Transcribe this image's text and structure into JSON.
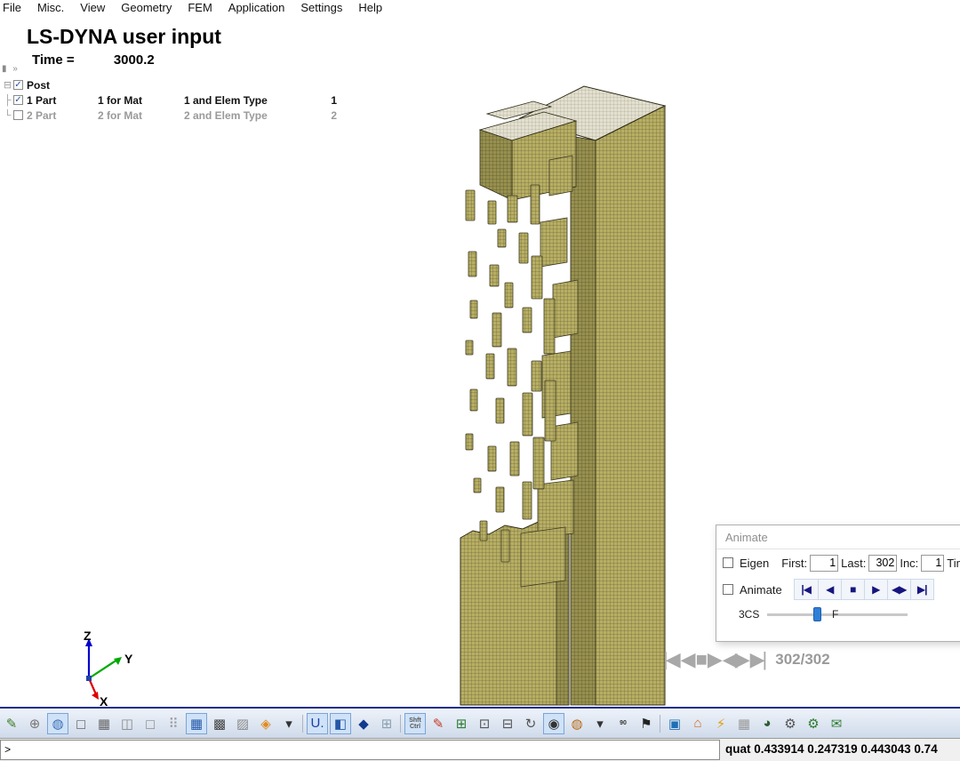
{
  "menu": {
    "items": [
      "File",
      "Misc.",
      "View",
      "Geometry",
      "FEM",
      "Application",
      "Settings",
      "Help"
    ]
  },
  "header": {
    "title": "LS-DYNA user input",
    "time_label": "Time =",
    "time_value": "3000.2"
  },
  "collapse_widget": "▮ »",
  "tree": {
    "root_label": "Post",
    "root_checked": true,
    "rows": [
      {
        "part": "1 Part",
        "mat": "1 for Mat",
        "elem": "1 and Elem Type",
        "num": "1",
        "checked": true
      },
      {
        "part": "2 Part",
        "mat": "2 for Mat",
        "elem": "2 and Elem Type",
        "num": "2",
        "checked": false
      }
    ]
  },
  "axis_triad": {
    "x_label": "X",
    "y_label": "Y",
    "z_label": "Z",
    "x_color": "#dd0000",
    "y_color": "#00aa00",
    "z_color": "#0000cc"
  },
  "animate_dialog": {
    "title": "Animate",
    "eigen_label": "Eigen",
    "first_label": "First:",
    "first_value": "1",
    "last_label": "Last:",
    "last_value": "302",
    "inc_label": "Inc:",
    "inc_value": "1",
    "time_label": "Tim",
    "animate_label": "Animate",
    "buttons": [
      "|◀",
      "◀",
      "■",
      "▶",
      "◀▶",
      "▶|"
    ],
    "cs_label": "3CS",
    "f_label": "F"
  },
  "viewport_playback": {
    "buttons": [
      "|◀",
      "◀",
      "■",
      "▶",
      "◀▶",
      "▶|"
    ],
    "counter": "302/302"
  },
  "statusbar": {
    "prompt": ">",
    "quat_text": "quat 0.433914 0.247319 0.443043 0.74"
  },
  "mesh_colors": {
    "fill": "#b7ae63",
    "line": "#55502e",
    "top_fill": "#e3e0cf",
    "dark_fill": "#97904f"
  },
  "toolbar": {
    "items": [
      {
        "name": "edit-green-icon",
        "glyph": "✎",
        "fg": "#3a7d22"
      },
      {
        "name": "wire-sphere-icon",
        "glyph": "⊕",
        "fg": "#777777"
      },
      {
        "name": "shaded-sphere-icon",
        "glyph": "◍",
        "fg": "#3b6fb5",
        "selected": true
      },
      {
        "name": "cube-outline-icon",
        "glyph": "◻",
        "fg": "#777777"
      },
      {
        "name": "cube-hatch-icon",
        "glyph": "▦",
        "fg": "#666666"
      },
      {
        "name": "cube-hidden-icon",
        "glyph": "◫",
        "fg": "#888888"
      },
      {
        "name": "cube-wire-icon",
        "glyph": "◻",
        "fg": "#999999"
      },
      {
        "name": "cube-dotted-icon",
        "glyph": "⠿",
        "fg": "#999999"
      },
      {
        "name": "cube-shaded-blue-icon",
        "glyph": "▦",
        "fg": "#2458a8",
        "selected": true
      },
      {
        "name": "cube-dark-icon",
        "glyph": "▩",
        "fg": "#444444"
      },
      {
        "name": "cube-gray-icon",
        "glyph": "▨",
        "fg": "#8a8a8a"
      },
      {
        "name": "diamond-icon",
        "glyph": "◈",
        "fg": "#e08a1e"
      },
      {
        "name": "view-dropdown-icon",
        "glyph": "▾",
        "fg": "#333333"
      },
      {
        "sep": true,
        "name": "toolbar-separator-1"
      },
      {
        "name": "u-displacement-icon",
        "glyph": "U.",
        "fg": "#1a3fa8",
        "selected": true,
        "small": false
      },
      {
        "name": "cube-blue-icon",
        "glyph": "◧",
        "fg": "#2458a8",
        "selected": true
      },
      {
        "name": "cube-navy-icon",
        "glyph": "◆",
        "fg": "#123a8f"
      },
      {
        "name": "grid-clover-icon",
        "glyph": "⊞",
        "fg": "#88a0b0"
      },
      {
        "sep": true,
        "name": "toolbar-separator-2"
      },
      {
        "name": "shift-ctrl-icon",
        "glyph": "Shft\nCtrl",
        "fg": "#555555",
        "selected": true,
        "small": true
      },
      {
        "name": "brush-icon",
        "glyph": "✎",
        "fg": "#c23b22"
      },
      {
        "name": "zoom-in-icon",
        "glyph": "⊞",
        "fg": "#2e7d32"
      },
      {
        "name": "zoom-window-icon",
        "glyph": "⊡",
        "fg": "#555555"
      },
      {
        "name": "zoom-out-icon",
        "glyph": "⊟",
        "fg": "#555555"
      },
      {
        "name": "rotate-icon",
        "glyph": "↻",
        "fg": "#555555"
      },
      {
        "name": "eye-icon",
        "glyph": "◉",
        "fg": "#333333",
        "selected": true
      },
      {
        "name": "globe-icon",
        "glyph": "◍",
        "fg": "#b86a14"
      },
      {
        "name": "angle-dropdown-icon",
        "glyph": "▾",
        "fg": "#333333"
      },
      {
        "name": "angle-90-label",
        "glyph": "90",
        "fg": "#333333",
        "small": true
      },
      {
        "name": "runner-icon",
        "glyph": "⚑",
        "fg": "#222222"
      },
      {
        "sep": true,
        "name": "toolbar-separator-3"
      },
      {
        "name": "cube-teal-icon",
        "glyph": "▣",
        "fg": "#1f6fb5"
      },
      {
        "name": "home-icon",
        "glyph": "⌂",
        "fg": "#d2691e"
      },
      {
        "name": "flash-page-icon",
        "glyph": "⚡",
        "fg": "#e0a012"
      },
      {
        "name": "checkerboard-icon",
        "glyph": "▦",
        "fg": "#999999"
      },
      {
        "name": "sphere-green-icon",
        "glyph": "◕",
        "fg": "#2e5d2e"
      },
      {
        "name": "gears-icon",
        "glyph": "⚙",
        "fg": "#555555"
      },
      {
        "name": "gears-green-icon",
        "glyph": "⚙",
        "fg": "#2e7d32"
      },
      {
        "name": "mail-icon",
        "glyph": "✉",
        "fg": "#2e7d32"
      }
    ]
  }
}
